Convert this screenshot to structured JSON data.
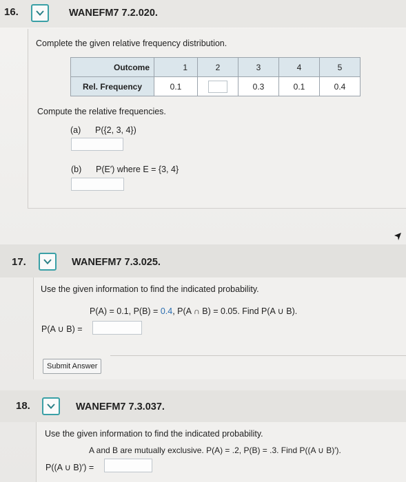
{
  "q16": {
    "number": "16.",
    "id": "WANEFM7 7.2.020.",
    "instruction": "Complete the given relative frequency distribution.",
    "table": {
      "row1_label": "Outcome",
      "outcomes": [
        "1",
        "2",
        "3",
        "4",
        "5"
      ],
      "row2_label": "Rel. Frequency",
      "frequencies": [
        "0.1",
        "",
        "0.3",
        "0.1",
        "0.4"
      ]
    },
    "compute_text": "Compute the relative frequencies.",
    "part_a_label": "(a)",
    "part_a_expr": "P({2, 3, 4})",
    "part_b_label": "(b)",
    "part_b_expr": "P(E′) where E = {3, 4}"
  },
  "q17": {
    "number": "17.",
    "id": "WANEFM7 7.3.025.",
    "instruction": "Use the given information to find the indicated probability.",
    "given_pre": "P(A) = 0.1, P(B) = ",
    "given_b": "0.4",
    "given_post": ", P(A ∩ B) = 0.05. Find P(A ∪ B).",
    "answer_label": "P(A ∪ B) =",
    "submit_label": "Submit Answer"
  },
  "q18": {
    "number": "18.",
    "id": "WANEFM7 7.3.037.",
    "instruction": "Use the given information to find the indicated probability.",
    "given": "A and B are mutually exclusive. P(A) = .2, P(B) = .3. Find P((A ∪ B)′).",
    "answer_label": "P((A ∪ B)′) ="
  },
  "colors": {
    "accent": "#3aa0a6",
    "table_header_bg": "#dbe6ec",
    "highlight": "#2a6db0"
  },
  "icons": {
    "expand": "chevron-down-icon",
    "cursor": "mouse-pointer-icon"
  }
}
